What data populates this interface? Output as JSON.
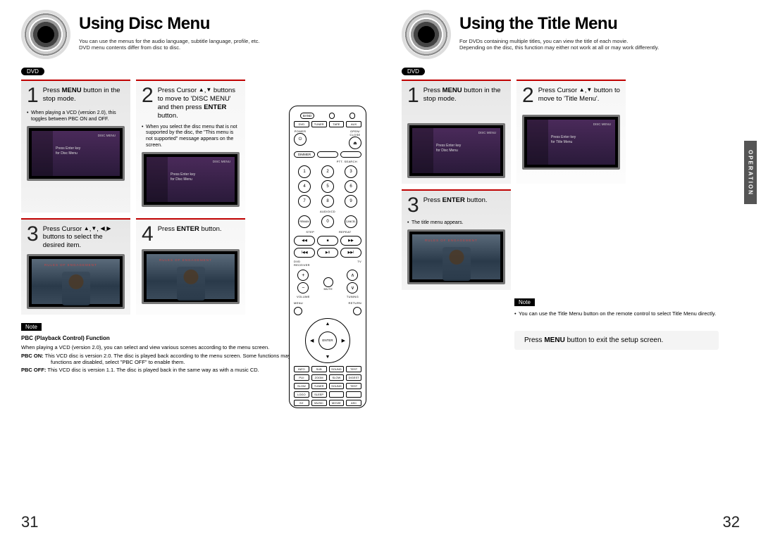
{
  "left": {
    "title": "Using Disc Menu",
    "subtitle": "You can use the menus for the audio language, subtitle language, profile, etc.\nDVD menu contents differ from disc to disc.",
    "badge": "DVD",
    "steps": [
      {
        "num": "1",
        "text": "Press <b>MENU</b> button in the stop mode.",
        "bullet": "When playing a VCD (version 2.0), this toggles between PBC ON and OFF.",
        "tv_header": "DISC MENU",
        "tv_lines": "Press Enter key\nfor Disc Menu"
      },
      {
        "num": "2",
        "alt": true,
        "text": "Press Cursor <span class='arrow'>▲</span>,<span class='arrow'>▼</span> buttons to move to 'DISC MENU' and then press <b>ENTER</b> button.",
        "bullet": "When you select the disc menu that is not supported by the disc, the \"This menu is not supported\" message appears on the screen.",
        "tv_header": "DISC MENU",
        "tv_lines": "Press Enter key\nfor Disc Menu"
      },
      {
        "num": "3",
        "text": "Press Cursor <span class='arrow'>▲</span>,<span class='arrow'>▼</span>, <span class='arrow'>◀</span>,<span class='arrow'>▶</span> buttons to select the desired item.",
        "photo": true,
        "photo_title": "RULES OF ENGAGEMENT"
      },
      {
        "num": "4",
        "alt": true,
        "text": "Press <b>ENTER</b> button.",
        "photo": true,
        "photo_title": "RULES OF ENGAGEMENT"
      }
    ],
    "note_label": "Note",
    "note_title": "PBC (Playback Control) Function",
    "note_intro": "When playing a VCD (version 2.0), you can select and view various scenes according to the menu screen.",
    "note_on": "<b>PBC ON:</b> This VCD disc is version 2.0. The disc is played back according to the menu screen. Some functions may be disabled. When some functions are disabled, select \"PBC OFF\" to enable them.",
    "note_off": "<b>PBC OFF:</b> This VCD disc is version 1.1. The disc is played back in the same way as with a music CD.",
    "page_num": "31"
  },
  "right": {
    "title": "Using the Title Menu",
    "subtitle": "For DVDs containing multiple titles, you can view the title of each movie.\nDepending on the disc, this function may either not work at all or may work differently.",
    "badge": "DVD",
    "steps": [
      {
        "num": "1",
        "text": "Press <b>MENU</b> button in the stop mode.",
        "tv_header": "DISC MENU",
        "tv_lines": "Press Enter key\nfor Disc Menu"
      },
      {
        "num": "2",
        "alt": true,
        "text": "Press Cursor <span class='arrow'>▲</span>,<span class='arrow'>▼</span> button to move to 'Title Menu'.",
        "tv_header": "DISC MENU",
        "tv_lines": "Press Enter key\nfor Title Menu"
      },
      {
        "num": "3",
        "text": "Press <b>ENTER</b> button.",
        "bullet": "The title menu appears.",
        "photo": true,
        "photo_title": "RULES OF ENGAGEMENT"
      }
    ],
    "note_label": "Note",
    "note_text": "You can use the Title Menu button on the remote control to select Title Menu directly.",
    "callout": "Press <b>MENU</b> button to exit the setup screen.",
    "side_tab": "OPERATION",
    "page_num": "32"
  },
  "remote": {
    "mode_row": [
      "BAND",
      " ",
      " "
    ],
    "src_row": [
      "DVD",
      "TUNER",
      "TAPE",
      "AUX"
    ],
    "top_row_l": "POWER",
    "top_row_r": "OPEN/\nCLOSE",
    "label_dimmer": "DIMMER",
    "label_dvd": " ",
    "label_tvvideo": " ",
    "label_ptt": "PTT. SEARCH",
    "numpad": [
      "1",
      "2",
      "3",
      "4",
      "5",
      "6",
      "7",
      "8",
      "9"
    ],
    "zero_row_l": "REMAIN",
    "zero_row_c": "0",
    "zero_row_r": "CANCEL",
    "label_audio": "AUDIO/CD",
    "label_step": "STEP",
    "label_repeat": "REPEAT",
    "label_receiver": "DVD\nRECEIVER",
    "label_tv": "TV",
    "label_mute": "MUTE",
    "label_volume": "VOLUME",
    "label_tuning": "TUNING",
    "label_menu": "MENU",
    "label_return": "RETURN",
    "dpad_center": "ENTER",
    "row_small1": [
      "INFO",
      "SUB",
      "SOUND",
      "TEST"
    ],
    "row_small2": [
      "PLII",
      "ZOOM",
      "SLOW",
      "DIGEST"
    ],
    "row_small3": [
      "SLOW",
      "TUNER",
      "SOUND",
      "TEST"
    ],
    "row_small4": [
      "LOGO",
      "SLEEP",
      " ",
      " "
    ],
    "row_ez": [
      "EZ",
      "MUSIC",
      "MOVIE",
      "ASC"
    ],
    "oval_row_l": "◀◀",
    "oval_row_c": "■",
    "oval_row_r": "▶▶",
    "oval_play": "▶Ⅱ"
  }
}
